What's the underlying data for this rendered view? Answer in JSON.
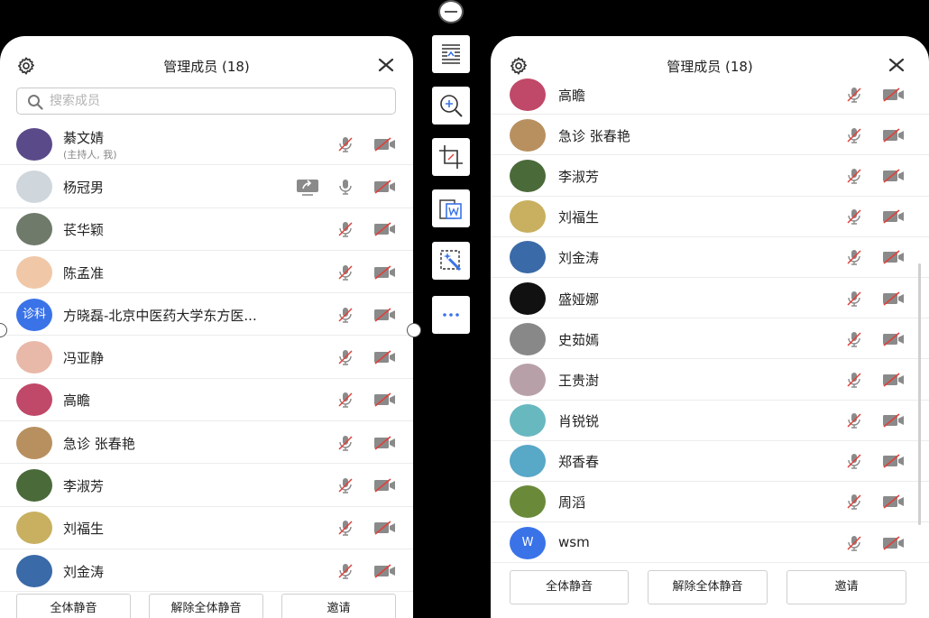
{
  "header": {
    "title": "管理成员 (18)"
  },
  "search": {
    "placeholder": "搜索成员"
  },
  "left_members": [
    {
      "name": "綦文婧",
      "sub": "(主持人, 我)",
      "avatar_color": "#5a4a8a",
      "mic": "muted",
      "cam": "off"
    },
    {
      "name": "杨冠男",
      "avatar_color": "#cfd6dc",
      "mic": "on",
      "cam": "off",
      "share": true
    },
    {
      "name": "苌华颖",
      "avatar_color": "#6f7a6a",
      "mic": "muted",
      "cam": "off"
    },
    {
      "name": "陈孟准",
      "avatar_color": "#f0c8a8",
      "mic": "muted",
      "cam": "off"
    },
    {
      "name": "方晓磊-北京中医药大学东方医...",
      "avatar_text": "诊科",
      "avatar_color": "#3a73e8",
      "mic": "muted",
      "cam": "off"
    },
    {
      "name": "冯亚静",
      "avatar_color": "#e8b8a8",
      "mic": "muted",
      "cam": "off"
    },
    {
      "name": "高瞻",
      "avatar_color": "#c04868",
      "mic": "muted",
      "cam": "off"
    },
    {
      "name": "急诊 张春艳",
      "avatar_color": "#b89060",
      "mic": "muted",
      "cam": "off"
    },
    {
      "name": "李淑芳",
      "avatar_color": "#4a6a3a",
      "mic": "muted",
      "cam": "off"
    },
    {
      "name": "刘福生",
      "avatar_color": "#c8b060",
      "mic": "muted",
      "cam": "off"
    },
    {
      "name": "刘金涛",
      "avatar_color": "#3a6aa8",
      "mic": "muted",
      "cam": "off"
    }
  ],
  "right_members": [
    {
      "name": "高瞻",
      "avatar_color": "#c04868",
      "mic": "muted",
      "cam": "off"
    },
    {
      "name": "急诊 张春艳",
      "avatar_color": "#b89060",
      "mic": "muted",
      "cam": "off"
    },
    {
      "name": "李淑芳",
      "avatar_color": "#4a6a3a",
      "mic": "muted",
      "cam": "off"
    },
    {
      "name": "刘福生",
      "avatar_color": "#c8b060",
      "mic": "muted",
      "cam": "off"
    },
    {
      "name": "刘金涛",
      "avatar_color": "#3a6aa8",
      "mic": "muted",
      "cam": "off"
    },
    {
      "name": "盛娅娜",
      "avatar_color": "#111111",
      "mic": "muted",
      "cam": "off"
    },
    {
      "name": "史茹嫣",
      "avatar_color": "#888888",
      "mic": "muted",
      "cam": "off"
    },
    {
      "name": "王贵澍",
      "avatar_color": "#b8a0a8",
      "mic": "muted",
      "cam": "off"
    },
    {
      "name": "肖锐锐",
      "avatar_color": "#68b8c0",
      "mic": "muted",
      "cam": "off"
    },
    {
      "name": "郑香春",
      "avatar_color": "#58a8c8",
      "mic": "muted",
      "cam": "off"
    },
    {
      "name": "周滔",
      "avatar_color": "#6a8a3a",
      "mic": "muted",
      "cam": "off"
    },
    {
      "name": "wsm",
      "avatar_text": "W",
      "avatar_color": "#3a73e8",
      "mic": "muted",
      "cam": "off"
    }
  ],
  "buttons": {
    "mute_all": "全体静音",
    "unmute_all": "解除全体静音",
    "invite": "邀请"
  },
  "colors": {
    "accent": "#3a73e8",
    "muted_red": "#e0403a",
    "icon_grey": "#8a8a8a"
  },
  "toolbar_icons": [
    "minus-circle-icon",
    "document-page-icon",
    "zoom-in-icon",
    "crop-icon",
    "word-export-icon",
    "magic-select-icon",
    "more-icon"
  ]
}
